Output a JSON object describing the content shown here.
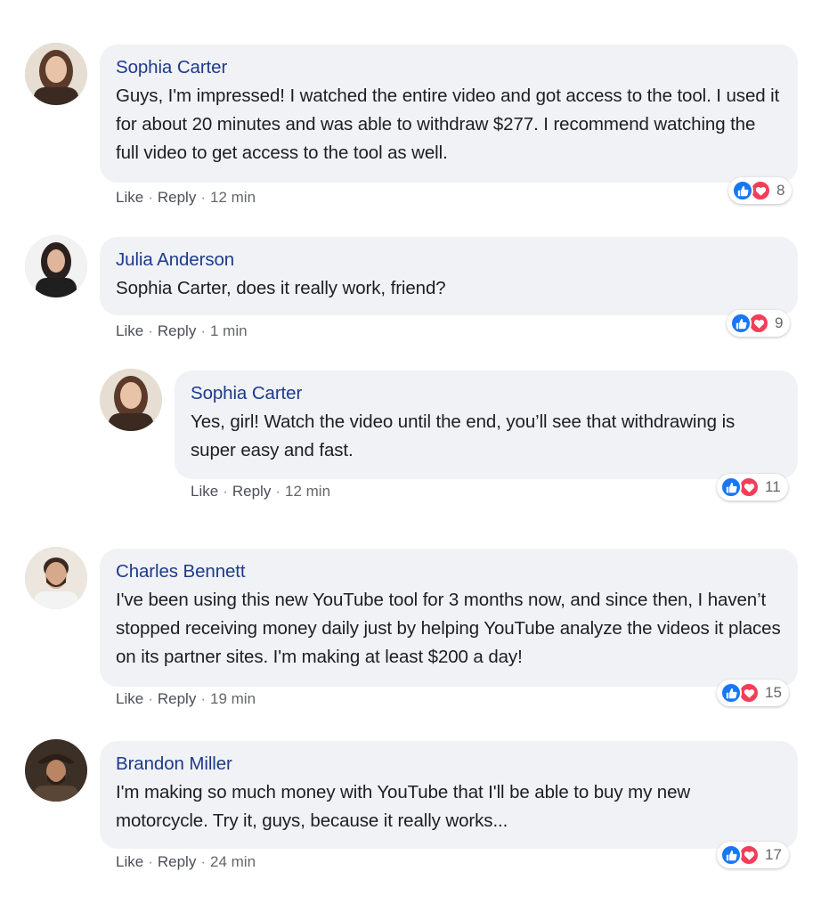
{
  "actions": {
    "like": "Like",
    "reply": "Reply",
    "separator": "·"
  },
  "colors": {
    "author": "#1e3a8a",
    "bubble": "#f0f2f5",
    "like_blue": "#1877f2",
    "love_red": "#f33e58"
  },
  "comments": [
    {
      "author": "Sophia Carter",
      "text": "Guys, I'm impressed! I watched the entire video and got access to the tool. I used it for about 20 minutes and was able to withdraw $277. I recommend watching the full video to get access to the tool as well.",
      "time": "12 min",
      "reaction_count": "8",
      "reaction_icons": [
        "like-icon",
        "love-icon"
      ]
    },
    {
      "author": "Julia Anderson",
      "text": "Sophia Carter, does it really work, friend?",
      "time": "1 min",
      "reaction_count": "9",
      "reaction_icons": [
        "like-icon",
        "love-icon"
      ]
    },
    {
      "author": "Sophia Carter",
      "text": "Yes, girl! Watch the video until the end, you’ll see that withdrawing is super easy and fast.",
      "time": "12 min",
      "reaction_count": "11",
      "reaction_icons": [
        "like-icon",
        "love-icon"
      ]
    },
    {
      "author": "Charles Bennett",
      "text": "I've been using this new YouTube tool for 3 months now, and since then, I haven’t stopped receiving money daily just by helping YouTube analyze the videos it places on its partner sites. I'm making at least $200 a day!",
      "time": "19 min",
      "reaction_count": "15",
      "reaction_icons": [
        "like-icon",
        "love-icon"
      ]
    },
    {
      "author": "Brandon Miller",
      "text": "I'm making so much money with YouTube that I'll be able to buy my new motorcycle. Try it, guys, because it really works...",
      "time": "24 min",
      "reaction_count": "17",
      "reaction_icons": [
        "like-icon",
        "love-icon"
      ]
    }
  ]
}
